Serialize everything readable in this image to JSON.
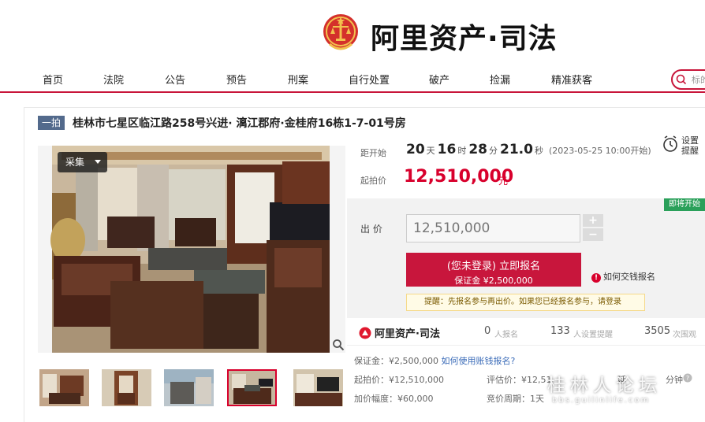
{
  "brand": {
    "title": "阿里资产·司法"
  },
  "nav": {
    "items": [
      "首页",
      "法院",
      "公告",
      "预告",
      "刑案",
      "自行处置",
      "破产",
      "捡漏",
      "精准获客"
    ],
    "search_placeholder": "标的"
  },
  "item": {
    "tag": "一拍",
    "title": "桂林市七星区临江路258号兴进· 漓江郡府·金桂府16栋1-7-01号房",
    "collect_label": "采集"
  },
  "countdown": {
    "label": "距开始",
    "days": "20",
    "days_unit": "天",
    "hours": "16",
    "hours_unit": "时",
    "minutes": "28",
    "minutes_unit": "分",
    "seconds": "21.0",
    "seconds_unit": "秒",
    "start_note": "(2023-05-25 10:00开始)"
  },
  "remind": {
    "label": "设置提醒"
  },
  "start_price": {
    "label": "起拍价",
    "value": "12,510,000",
    "unit": "元"
  },
  "bid": {
    "status_badge": "即将开始",
    "label": "出 价",
    "value": "12,510,000",
    "plus": "+",
    "minus": "−",
    "register_line1": "(您未登录) 立即报名",
    "register_line2": "保证金 ¥2,500,000",
    "how_pay": "如何交钱报名",
    "notice": "提醒：先报名参与再出价。如果您已经报名参与，请登录"
  },
  "stats": {
    "logo": "阿里资产·司法",
    "registered_num": "0",
    "registered_label": "人报名",
    "remind_num": "133",
    "remind_label": "人设置提醒",
    "views_num": "3505",
    "views_label": "次围观"
  },
  "details": {
    "deposit": "保证金：¥2,500,000",
    "deposit_link": "如何使用账钱报名?",
    "start_price": "起拍价：¥12,510,000",
    "appraisal": "评估价：¥12,51",
    "delay": "延",
    "delay_unit": "分钟",
    "increment": "加价幅度：¥60,000",
    "period": "竞价周期：1天"
  },
  "watermark": {
    "text": "桂林人论坛",
    "url": "bbs.guilinlife.com"
  },
  "colors": {
    "accent": "#c8153a",
    "price": "#d8002c",
    "badge": "#2aa05a",
    "tag": "#536a8c"
  }
}
